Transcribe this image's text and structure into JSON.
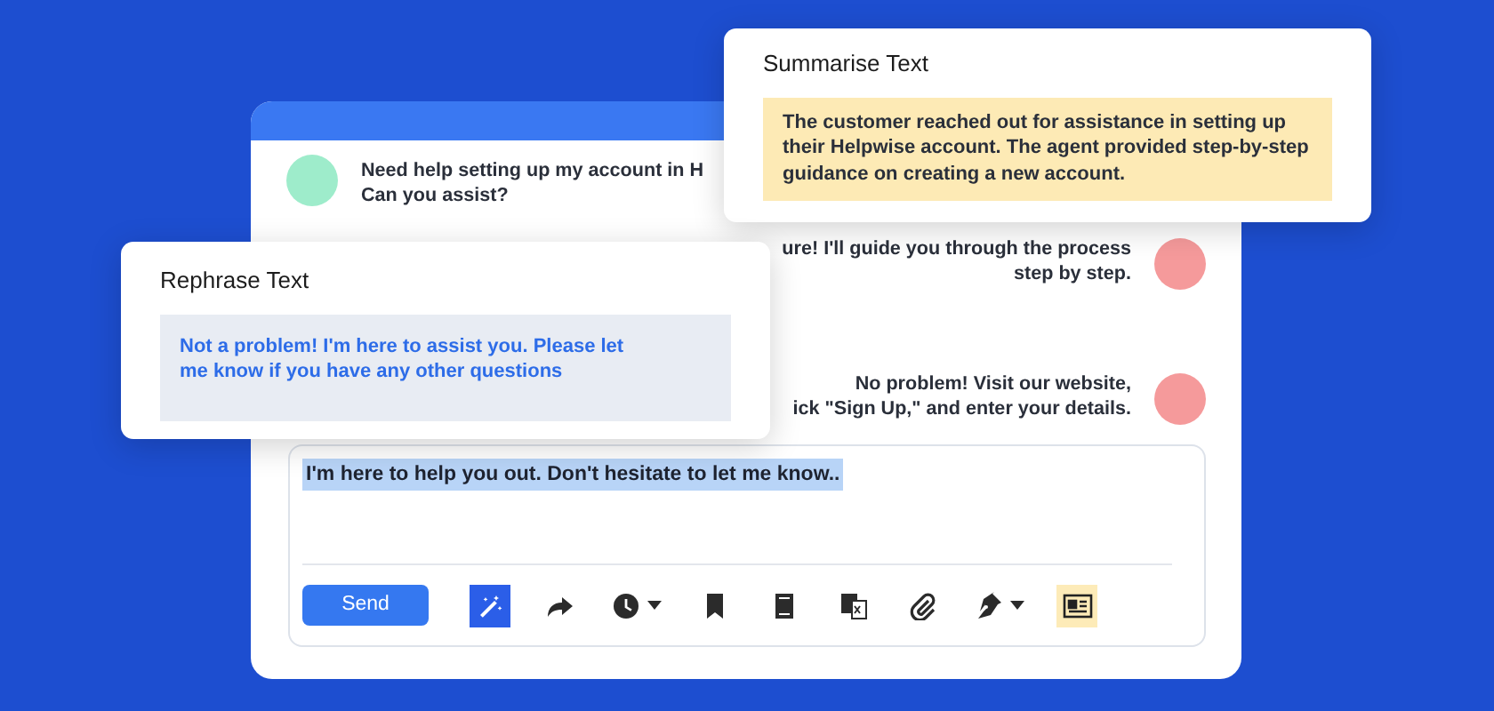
{
  "chat_window": {
    "messages": [
      {
        "kind": "incoming",
        "color": "#9eeccb",
        "text": "Need help setting up my account in H\nCan you assist?"
      },
      {
        "kind": "outgoing",
        "color": "#f59a9b",
        "text": "ure! I'll guide you through the process\nstep by step."
      },
      {
        "kind": "outgoing",
        "color": "#f59a9b",
        "text": "No problem! Visit our website,\nick \"Sign Up,\" and enter your details."
      }
    ],
    "composer": {
      "value": "I'm here to help you out. Don't hesitate to let me know..",
      "selected": true
    },
    "toolbar": [
      {
        "kind": "send",
        "label": "Send"
      },
      {
        "kind": "wand",
        "active": true
      },
      {
        "kind": "forward",
        "active": false
      },
      {
        "kind": "clock",
        "active": false,
        "menu": true
      },
      {
        "kind": "bookmark",
        "active": false
      },
      {
        "kind": "book",
        "active": false
      },
      {
        "kind": "translate",
        "active": false
      },
      {
        "kind": "clip",
        "active": false
      },
      {
        "kind": "pen",
        "active": false,
        "menu": true
      },
      {
        "kind": "card",
        "active": true
      }
    ]
  },
  "summarise_panel": {
    "title": "Summarise Text",
    "text": "The customer reached out for assistance in setting up their Helpwise account. The agent provided step-by-step guidance on creating a new account."
  },
  "rephrase_panel": {
    "title": "Rephrase Text",
    "text": "Not a problem! I'm here to assist you. Please let me know if you have any other questions"
  }
}
